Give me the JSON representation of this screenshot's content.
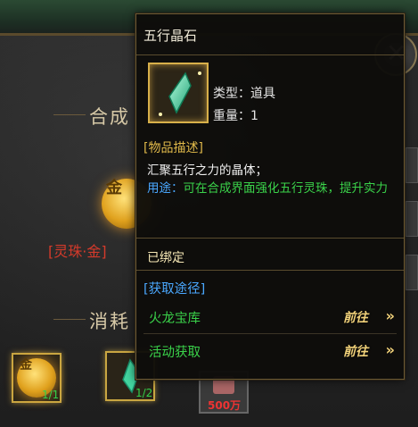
{
  "tooltip": {
    "title": "五行晶石",
    "type_label": "类型：道具",
    "weight_label": "重量：1",
    "desc_header": "[物品描述]",
    "desc_body": "汇聚五行之力的晶体；",
    "usage_label": "用途：",
    "usage_text": "可在合成界面强化五行灵珠，提升实力",
    "bound": "已绑定",
    "source_header": "[获取途径]",
    "sources": [
      {
        "name": "火龙宝库",
        "button": "前往"
      },
      {
        "name": "活动获取",
        "button": "前往"
      }
    ],
    "item_icon": "green-crystal-icon"
  },
  "background": {
    "synth_title": "合成",
    "consume_title": "消耗",
    "orb_char": "金",
    "orb_name": "[灵珠·金]",
    "slots": [
      {
        "icon": "gold-orb-icon",
        "count": "1/1"
      },
      {
        "icon": "green-crystal-icon",
        "count": "1/2"
      },
      {
        "icon": "currency-icon",
        "count": "500万"
      }
    ]
  },
  "colors": {
    "green": "#3ad24a",
    "blue": "#4aa8ff",
    "gold": "#e0b94a"
  }
}
